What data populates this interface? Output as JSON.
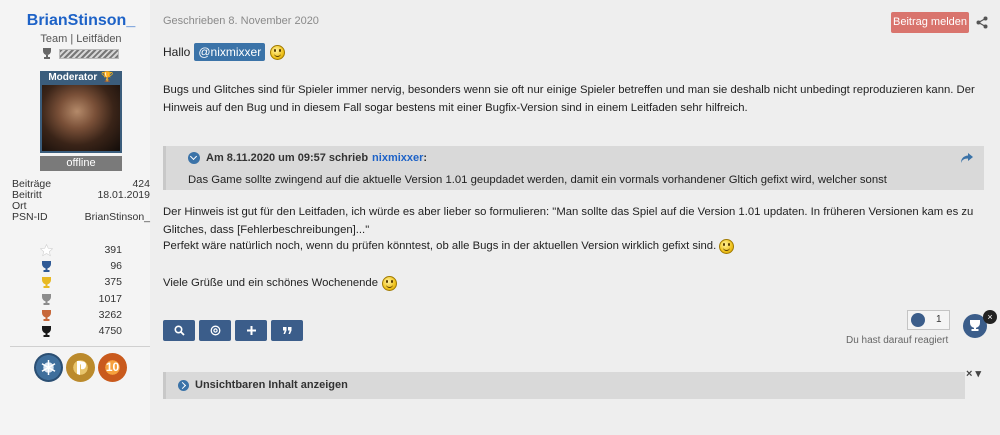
{
  "sidebar": {
    "username": "BrianStinson_",
    "user_title": "Team | Leitfäden",
    "role_label": "Moderator",
    "status": "offline",
    "stats": [
      {
        "label": "Beiträge",
        "value": "424"
      },
      {
        "label": "Beitritt",
        "value": "18.01.2019"
      },
      {
        "label": "Ort",
        "value": ""
      },
      {
        "label": "PSN-ID",
        "value": "BrianStinson_"
      }
    ],
    "trophies": [
      {
        "type": "star",
        "count": "391",
        "color": "#ffffff"
      },
      {
        "type": "platinum",
        "count": "96",
        "color": "#2f5a96"
      },
      {
        "type": "gold",
        "count": "375",
        "color": "#e8b923"
      },
      {
        "type": "silver",
        "count": "1017",
        "color": "#8c8c8c"
      },
      {
        "type": "bronze",
        "count": "3262",
        "color": "#c7683a"
      },
      {
        "type": "total",
        "count": "4750",
        "color": "#1a1a1a"
      }
    ],
    "badges": [
      {
        "icon": "snowflake-badge-icon"
      },
      {
        "icon": "playstation-badge-icon"
      },
      {
        "icon": "level-badge-icon",
        "text": "10"
      }
    ]
  },
  "post": {
    "date": "Geschrieben 8. November 2020",
    "report_label": "Beitrag melden",
    "greeting": "Hallo",
    "mention": "@nixmixxer",
    "paragraph1": "Bugs und Glitches sind für Spieler immer nervig, besonders wenn sie oft nur einige Spieler betreffen und man sie deshalb nicht unbedingt reproduzieren kann. Der Hinweis auf den Bug und in diesem Fall sogar bestens mit einer Bugfix-Version sind in einem Leitfaden sehr hilfreich.",
    "quote": {
      "header": "Am 8.11.2020 um 09:57 schrieb",
      "author": "nixmixxer",
      "colon": ":",
      "text": "Das Game sollte zwingend auf die aktuelle Version 1.01 geupdadet werden, damit ein vormals vorhandener Gltich gefixt wird, welcher sonst"
    },
    "paragraph2": "Der Hinweis ist gut für den Leitfaden, ich würde es aber lieber so formulieren: \"Man sollte das Spiel auf die Version 1.01 updaten. In früheren Versionen kam es zu Glitches, dass [Fehlerbeschreibungen]...\"",
    "paragraph3": "Perfekt wäre natürlich noch, wenn du prüfen könntest, ob alle Bugs in der aktuellen Version wirklich gefixt sind.",
    "paragraph4": "Viele Grüße und ein schönes Wochenende",
    "reaction": {
      "count": "1",
      "note": "Du hast darauf reagiert",
      "close": "×"
    },
    "hidden_content_label": "Unsichtbaren Inhalt anzeigen",
    "corner_controls": "× ▾"
  },
  "colors": {
    "username": "#1d62c7",
    "report_button": "#d9746d",
    "mention_bg": "#3b73a8",
    "action_button": "#3b5d8a"
  }
}
